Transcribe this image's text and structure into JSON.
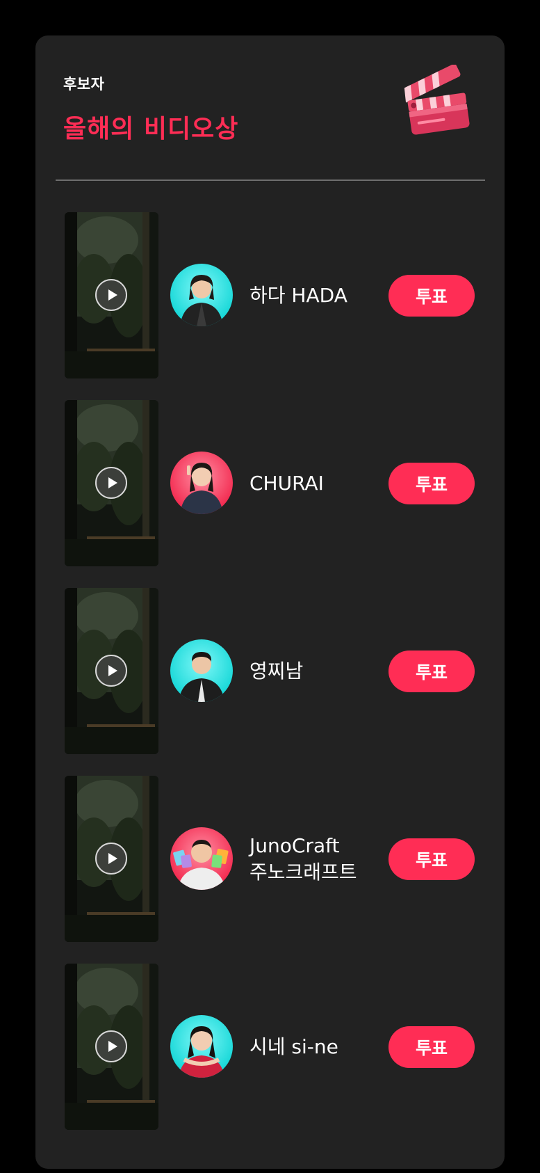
{
  "header": {
    "eyebrow": "후보자",
    "title": "올해의 비디오상",
    "icon": "clapperboard-icon"
  },
  "colors": {
    "accent": "#ff2d55",
    "card_background": "#222222",
    "page_background": "#000000",
    "avatar_cyan": "#1ee4e4",
    "avatar_pink": "#ff3b5f"
  },
  "nominees": [
    {
      "name_line1": "하다 HADA",
      "name_line2": "",
      "vote_label": "투표",
      "avatar_bg": "cyan"
    },
    {
      "name_line1": "CHURAI",
      "name_line2": "",
      "vote_label": "투표",
      "avatar_bg": "pink"
    },
    {
      "name_line1": "영찌남",
      "name_line2": "",
      "vote_label": "투표",
      "avatar_bg": "cyan"
    },
    {
      "name_line1": "JunoCraft",
      "name_line2": "주노크래프트",
      "vote_label": "투표",
      "avatar_bg": "pink"
    },
    {
      "name_line1": "시네 si-ne",
      "name_line2": "",
      "vote_label": "투표",
      "avatar_bg": "cyan"
    }
  ]
}
